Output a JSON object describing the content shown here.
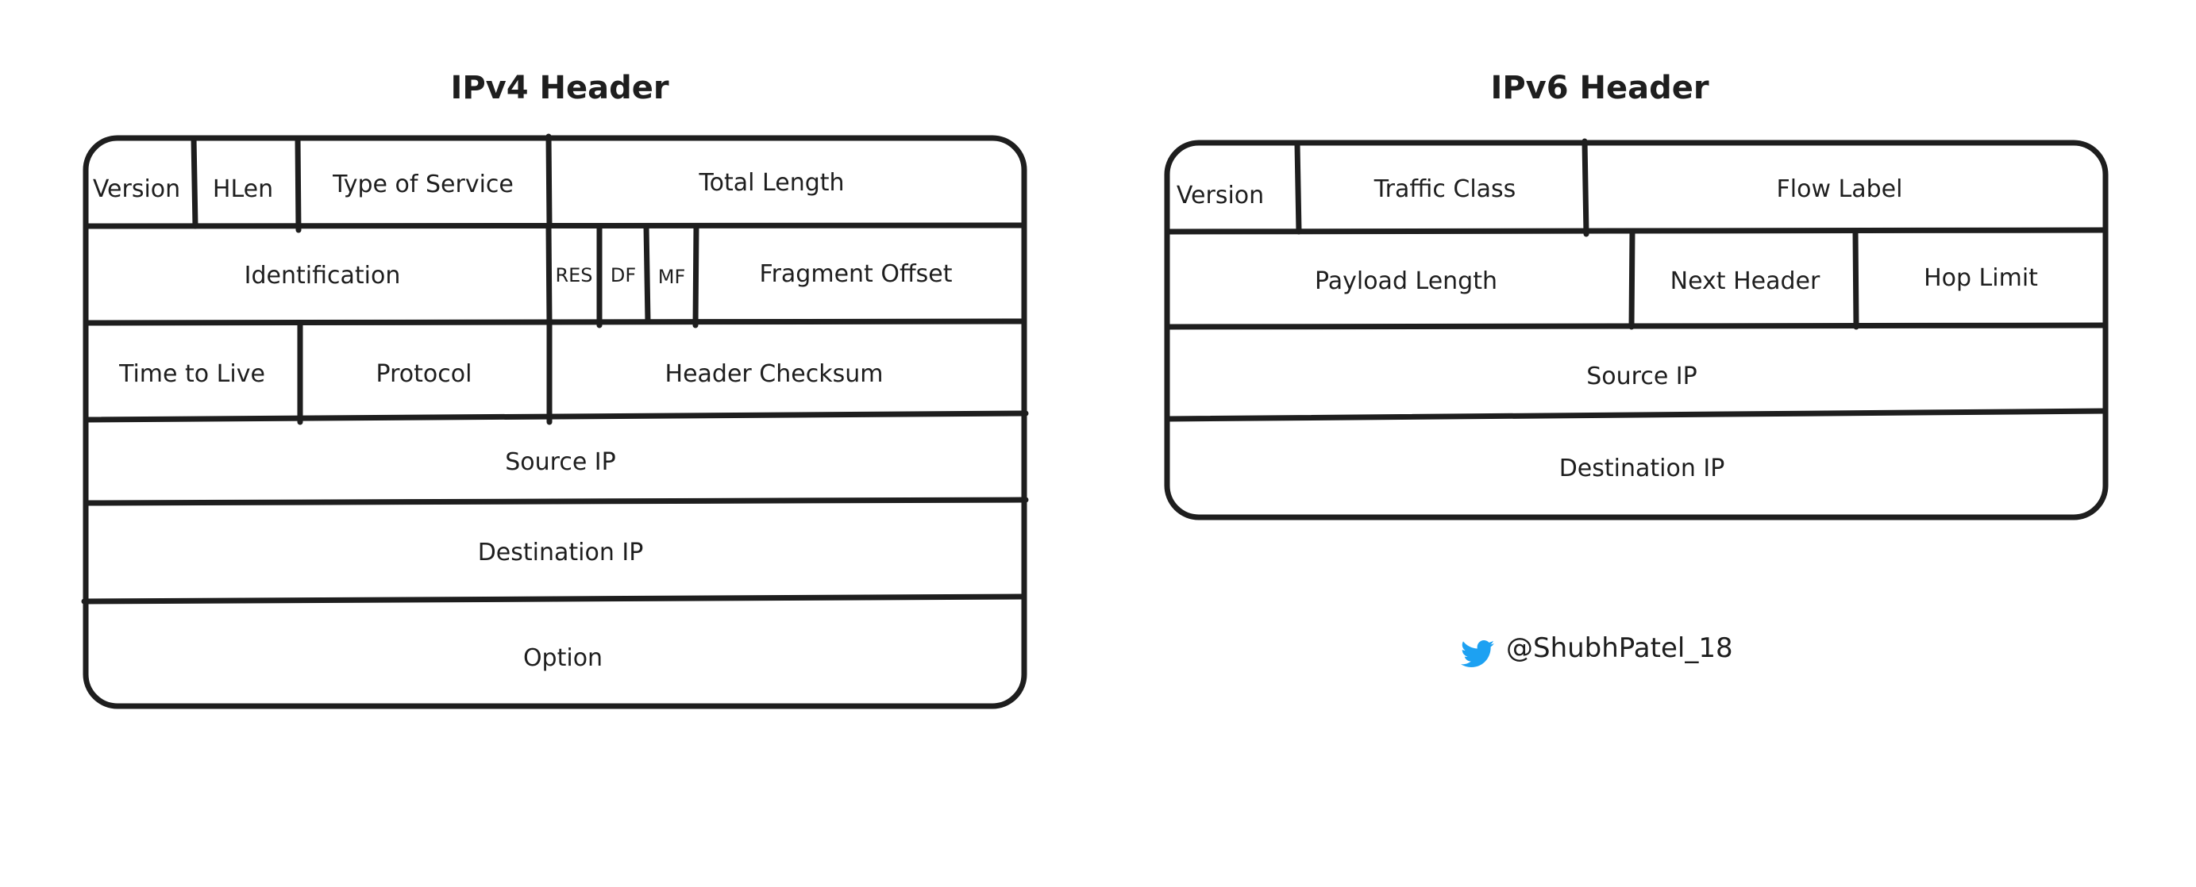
{
  "ipv4": {
    "title": "IPv4 Header",
    "rows": [
      [
        "Version",
        "HLen",
        "Type of Service",
        "Total Length"
      ],
      [
        "Identification",
        "RES",
        "DF",
        "MF",
        "Fragment Offset"
      ],
      [
        "Time to Live",
        "Protocol",
        "Header Checksum"
      ],
      [
        "Source IP"
      ],
      [
        "Destination IP"
      ],
      [
        "Option"
      ]
    ]
  },
  "ipv6": {
    "title": "IPv6 Header",
    "rows": [
      [
        "Version",
        "Traffic Class",
        "Flow Label"
      ],
      [
        "Payload Length",
        "Next Header",
        "Hop Limit"
      ],
      [
        "Source IP"
      ],
      [
        "Destination IP"
      ]
    ]
  },
  "credit": {
    "icon": "twitter-bird-icon",
    "handle": "@ShubhPatel_18",
    "icon_color": "#1DA1F2"
  }
}
